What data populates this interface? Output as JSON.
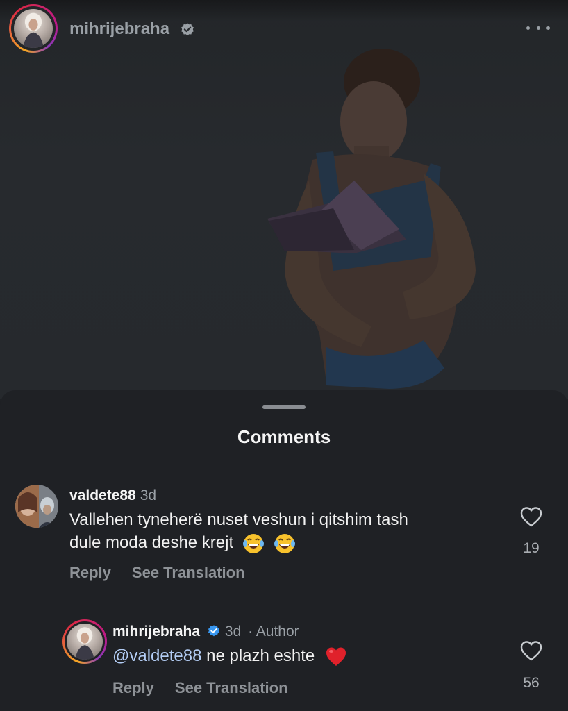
{
  "post": {
    "username": "mihrijebraha",
    "verified": true,
    "avatar_icon": "profile-avatar",
    "more_icon": "more-options-icon"
  },
  "comments_sheet": {
    "title": "Comments",
    "comments": [
      {
        "username": "valdete88",
        "time": "3d",
        "text_line1": "Vallehen tyneherë nuset veshun i qitshim tash",
        "text_line2": "dule moda deshe krejt",
        "emojis": [
          "laughing-tears-emoji",
          "laughing-tears-emoji"
        ],
        "likes": "19",
        "reply_label": "Reply",
        "translate_label": "See Translation"
      },
      {
        "username": "mihrijebraha",
        "verified": true,
        "time": "3d",
        "author_label": "· Author",
        "mention": "@valdete88",
        "text": " ne plazh eshte",
        "emoji": "red-heart-emoji",
        "likes": "56",
        "reply_label": "Reply",
        "translate_label": "See Translation"
      }
    ]
  },
  "colors": {
    "background": "#1f2125",
    "mention": "#b3cdf5",
    "verified": "#3897f0",
    "heart": "#e0212b"
  }
}
